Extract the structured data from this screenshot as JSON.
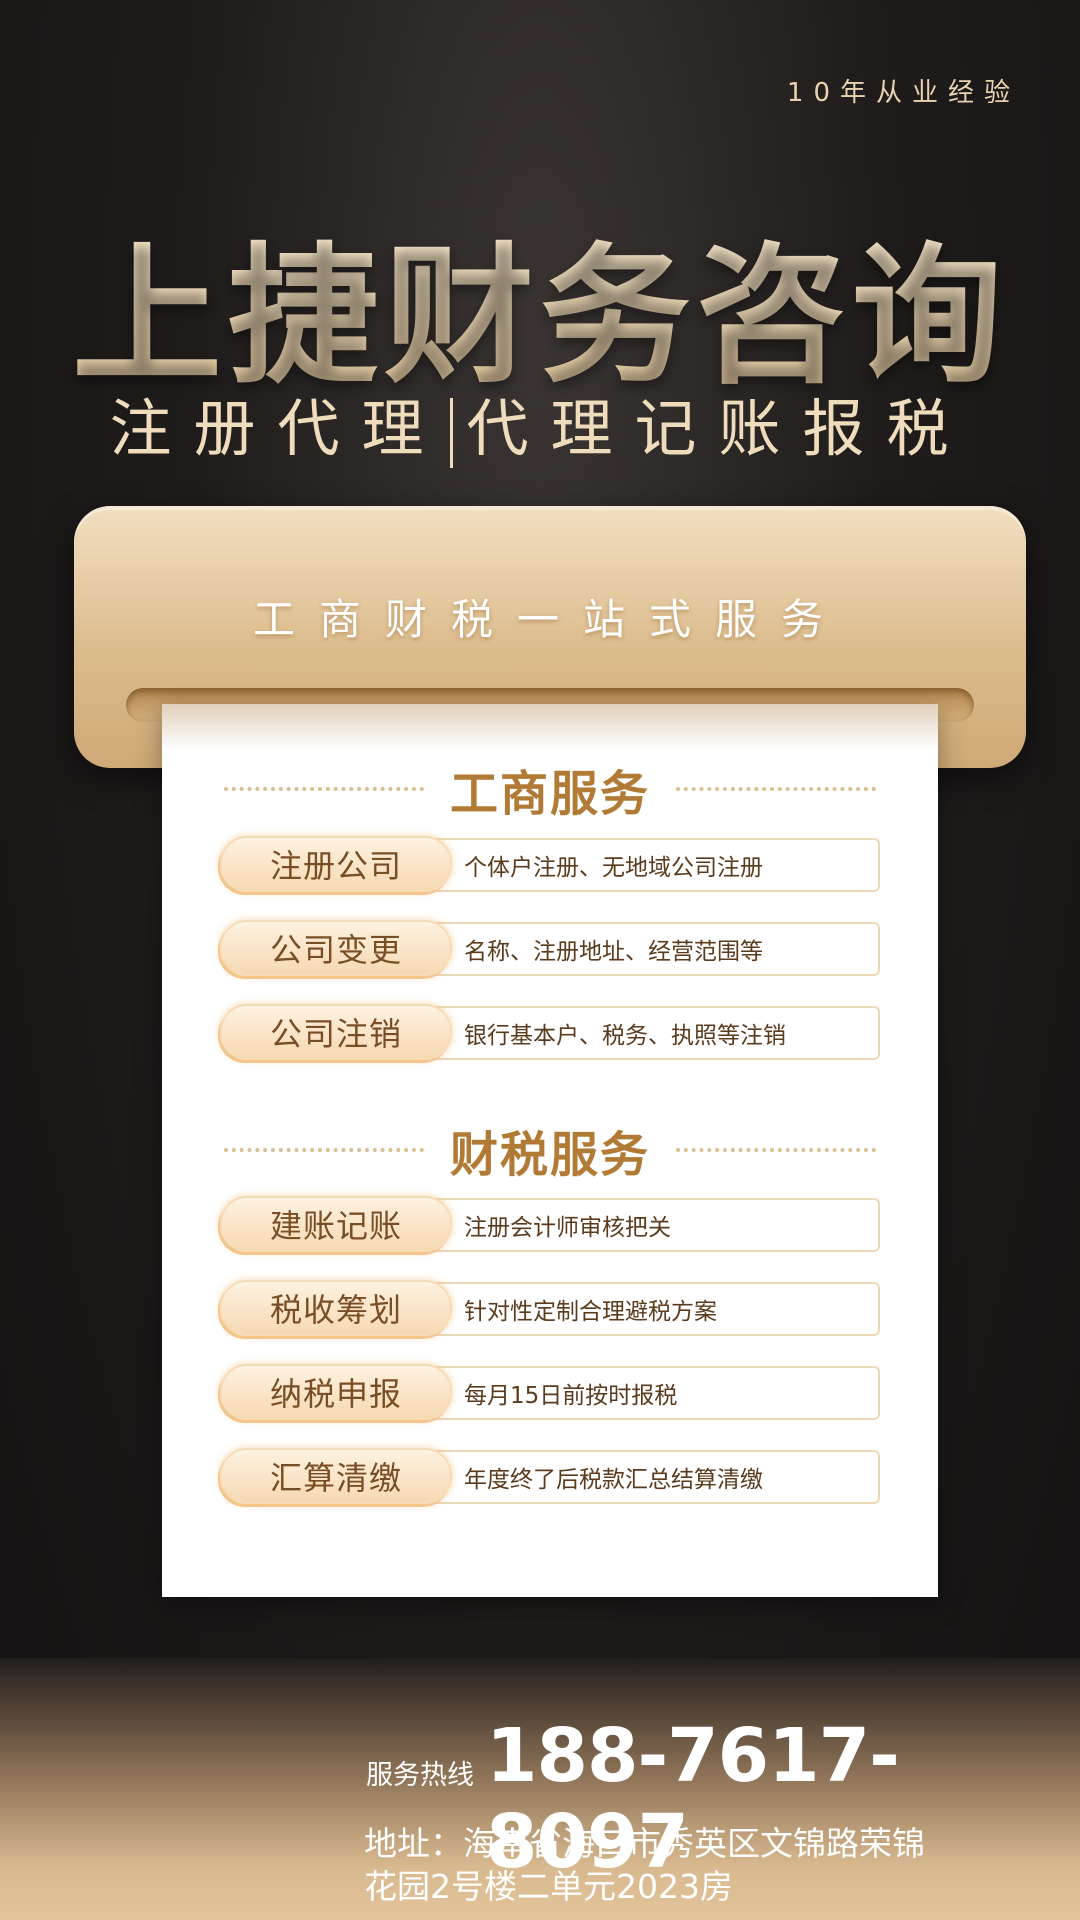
{
  "tagline": "10年从业经验",
  "brand": "上捷财务咨询",
  "subtitle": {
    "left": "注册代理",
    "right": "代理记账报税"
  },
  "banner": "工商财税一站式服务",
  "sections": [
    {
      "title": "工商服务",
      "items": [
        {
          "name": "注册公司",
          "desc": "个体户注册、无地域公司注册"
        },
        {
          "name": "公司变更",
          "desc": "名称、注册地址、经营范围等"
        },
        {
          "name": "公司注销",
          "desc": "银行基本户、税务、执照等注销"
        }
      ]
    },
    {
      "title": "财税服务",
      "items": [
        {
          "name": "建账记账",
          "desc": "注册会计师审核把关"
        },
        {
          "name": "税收筹划",
          "desc": "针对性定制合理避税方案"
        },
        {
          "name": "纳税申报",
          "desc": "每月15日前按时报税"
        },
        {
          "name": "汇算清缴",
          "desc": "年度终了后税款汇总结算清缴"
        }
      ]
    }
  ],
  "footer": {
    "hotline_label": "服务热线",
    "hotline_number": "188-7617-8097",
    "address_line1": "地址：海南省海口市秀英区文锦路荣锦",
    "address_line2": "花园2号楼二单元2023房"
  },
  "colors": {
    "gold": "#e2c79c",
    "brown_text": "#b17a35",
    "background": "#1f1c1b"
  }
}
